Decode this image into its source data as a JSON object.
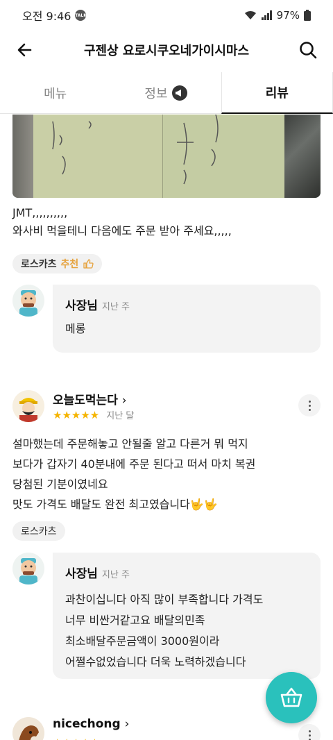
{
  "status_bar": {
    "time": "오전 9:46",
    "talk_badge": "TALK",
    "battery": "97%"
  },
  "header": {
    "title": "구젠상 요로시쿠오네가이시마스"
  },
  "tabs": [
    {
      "label": "메뉴"
    },
    {
      "label": "정보"
    },
    {
      "label": "리뷰"
    }
  ],
  "review1": {
    "lines": [
      "JMT,,,,,,,,,,",
      "와사비 먹을테니 다음에도 주문 받아 주세요,,,,,"
    ],
    "menu_chip": "로스카츠",
    "recommend_label": "추천",
    "owner_reply": {
      "name": "사장님",
      "time": "지난 주",
      "text": [
        "메롱"
      ]
    }
  },
  "review2": {
    "author": "오늘도먹는다",
    "stars": "★★★★★",
    "rating": 5,
    "time": "지난 달",
    "lines": [
      "설마했는데 주문해놓고 안될줄 알고 다른거 뭐 먹지",
      "보다가 갑자기 40분내에 주문 된다고 떠서 마치 복권",
      "당첨된 기분이였네요",
      "맛도 가격도 배달도 완전 최고였습니다🤟🤟"
    ],
    "menu_chip": "로스카츠",
    "owner_reply": {
      "name": "사장님",
      "time": "지난 주",
      "text": [
        "과찬이십니다 아직 많이 부족합니다 가격도",
        "너무 비싼거같고요 배달의민족",
        "최소배달주문금액이 3000원이라",
        "어쩔수없었습니다 더욱 노력하겠습니다"
      ]
    }
  },
  "review3": {
    "author": "nicechong"
  },
  "colors": {
    "accent": "#2ac1bc",
    "star": "#f5b400",
    "recommend": "#e6a23c"
  }
}
